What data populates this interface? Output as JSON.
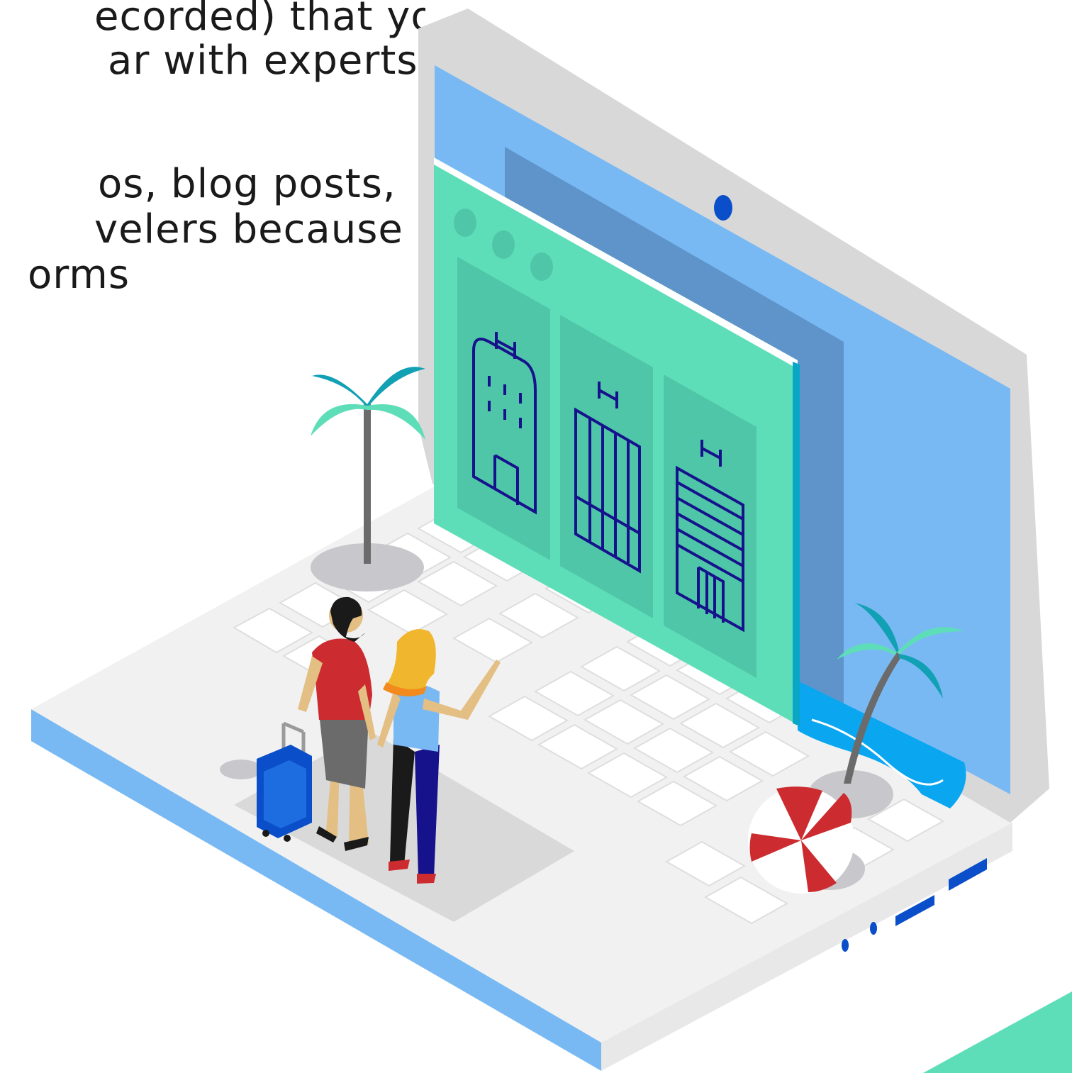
{
  "text_lines": [
    "ecorded) that you",
    "ar with experts",
    "os, blog posts,",
    "velers because",
    "orms"
  ],
  "illustration": {
    "subject": "isometric laptop with hotel booking screen and travellers",
    "icons": [
      "laptop-icon",
      "hotel-building-icon",
      "palm-tree-icon",
      "beach-umbrella-icon",
      "suitcase-icon",
      "traveller-man-icon",
      "traveller-woman-icon"
    ],
    "hotel_sign_letter": "H"
  },
  "colors": {
    "screen_blue": "#78b9f4",
    "screen_dark": "#5e94ca",
    "panel_green": "#5ddeb8",
    "panel_green_dark": "#50c6a8",
    "outline_navy": "#16128c",
    "laptop_grey": "#d9d9d9",
    "keyboard_white": "#f4f4f4",
    "accent_blue": "#0a4fc9",
    "umbrella_red": "#cc2b2f",
    "palm_teal": "#12a0b4"
  }
}
